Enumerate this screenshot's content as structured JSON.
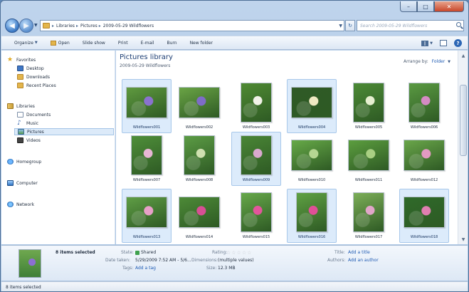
{
  "window": {
    "controls": [
      "–",
      "□",
      "✕"
    ]
  },
  "nav": {
    "back": "◀",
    "forward": "▶",
    "history": "▼"
  },
  "address": {
    "breadcrumb": [
      "Libraries",
      "Pictures",
      "2009-05-29 Wildflowers"
    ],
    "separator": "▸",
    "dropdown": "▼",
    "refresh": "↻"
  },
  "search": {
    "placeholder": "Search 2009-05-29 Wildflowers"
  },
  "toolbar": {
    "items": [
      "Organize",
      "Open",
      "Slide show",
      "Print",
      "E-mail",
      "Burn",
      "New folder"
    ],
    "organize_caret": "▼",
    "views_caret": "▼",
    "help": "?"
  },
  "sidebar": {
    "favorites": {
      "label": "Favorites",
      "items": [
        "Desktop",
        "Downloads",
        "Recent Places"
      ]
    },
    "libraries": {
      "label": "Libraries",
      "items": [
        "Documents",
        "Music",
        "Pictures",
        "Videos"
      ],
      "selected": "Pictures"
    },
    "homegroup": "Homegroup",
    "computer": "Computer",
    "network": "Network"
  },
  "library": {
    "title": "Pictures library",
    "subtitle": "2009-05-29 Wildflowers",
    "arrange_label": "Arrange by:",
    "arrange_value": "Folder",
    "arrange_caret": "▼"
  },
  "files": [
    {
      "name": "Wildflowers001",
      "selected": true,
      "palette": [
        "#5f9a3f",
        "#8a72cf"
      ]
    },
    {
      "name": "Wildflowers002",
      "selected": false,
      "palette": [
        "#6aa445",
        "#7e6cc8"
      ]
    },
    {
      "name": "Wildflowers003",
      "selected": false,
      "palette": [
        "#4f8a33",
        "#f2f2e8"
      ]
    },
    {
      "name": "Wildflowers004",
      "selected": true,
      "palette": [
        "#2f5a26",
        "#efe9c2"
      ]
    },
    {
      "name": "Wildflowers005",
      "selected": false,
      "palette": [
        "#4c8a36",
        "#e6efd0"
      ]
    },
    {
      "name": "Wildflowers006",
      "selected": false,
      "palette": [
        "#5a9a42",
        "#d58bc4"
      ]
    },
    {
      "name": "Wildflowers007",
      "selected": false,
      "palette": [
        "#4f8f3a",
        "#e7b6d4"
      ]
    },
    {
      "name": "Wildflowers008",
      "selected": false,
      "palette": [
        "#5c9c45",
        "#cfe0b0"
      ]
    },
    {
      "name": "Wildflowers009",
      "selected": true,
      "palette": [
        "#4a8636",
        "#d9a9cf"
      ]
    },
    {
      "name": "Wildflowers010",
      "selected": false,
      "palette": [
        "#67aa48",
        "#b5d692"
      ]
    },
    {
      "name": "Wildflowers011",
      "selected": false,
      "palette": [
        "#5c9e3f",
        "#a9cf83"
      ]
    },
    {
      "name": "Wildflowers012",
      "selected": false,
      "palette": [
        "#6aa64a",
        "#e39ac2"
      ]
    },
    {
      "name": "Wildflowers013",
      "selected": true,
      "palette": [
        "#5f9e45",
        "#e8a0c8"
      ]
    },
    {
      "name": "Wildflowers014",
      "selected": false,
      "palette": [
        "#4d8a37",
        "#d84f94"
      ]
    },
    {
      "name": "Wildflowers015",
      "selected": false,
      "palette": [
        "#66a84a",
        "#e3559c"
      ]
    },
    {
      "name": "Wildflowers016",
      "selected": true,
      "palette": [
        "#5fa143",
        "#df4f97"
      ]
    },
    {
      "name": "Wildflowers017",
      "selected": false,
      "palette": [
        "#7cae58",
        "#e1a6c9"
      ]
    },
    {
      "name": "Wildflowers018",
      "selected": true,
      "palette": [
        "#2f6a2a",
        "#e07fb1"
      ]
    }
  ],
  "details": {
    "count": "8 items selected",
    "state_label": "State:",
    "state_value": "Shared",
    "date_label": "Date taken:",
    "date_value": "5/29/2009 7:52 AM - 5/6...",
    "tags_label": "Tags:",
    "tags_value": "Add a tag",
    "rating_label": "Rating:",
    "stars": [
      "☆",
      "☆",
      "☆",
      "☆",
      "☆"
    ],
    "dimensions_label": "Dimensions:",
    "dimensions_value": "(multiple values)",
    "size_label": "Size:",
    "size_value": "12.3 MB",
    "title_label": "Title:",
    "title_value": "Add a title",
    "authors_label": "Authors:",
    "authors_value": "Add an author"
  },
  "status": {
    "text": "8 items selected"
  },
  "colors": {
    "accent": "#1f5bb3",
    "selection": "#dcebfb",
    "title": "#1e3f74"
  }
}
